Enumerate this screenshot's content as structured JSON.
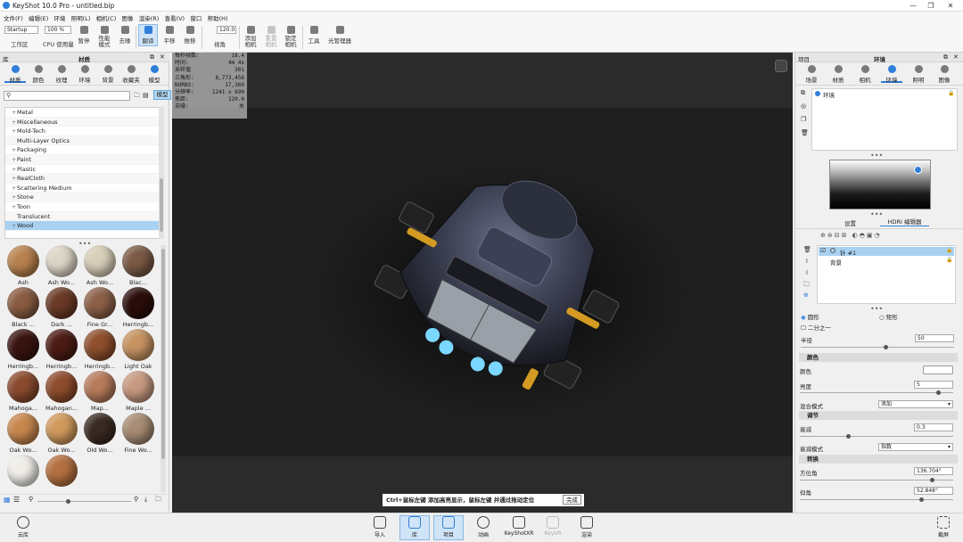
{
  "title": "KeyShot 10.0 Pro  - untitled.bip",
  "menu": [
    "文件(F)",
    "编辑(E)",
    "环境",
    "照明(L)",
    "相机(C)",
    "图像",
    "渲染(R)",
    "查看(V)",
    "窗口",
    "帮助(H)"
  ],
  "toolbar": {
    "workspace_select": "Startup",
    "workspace_label": "工作区",
    "zoom_select": "100 %",
    "cpu_label": "CPU 使用量",
    "pause_label": "暂停",
    "perf_label": "性能\n模式",
    "denoise_label": "去噪",
    "flip_label": "翻译",
    "pan_label": "平移",
    "push_label": "推移",
    "fov_value": "120.0",
    "fov_label": "视角",
    "add_camera_label": "添加\n相机",
    "reset_camera_label": "重置\n相机",
    "lock_camera_label": "锁定\n相机",
    "tools_label": "工具",
    "light_manager_label": "光管理器"
  },
  "library": {
    "panel_title": "库",
    "material_header": "材质",
    "tabs": [
      "材质",
      "颜色",
      "纹理",
      "环境",
      "背景",
      "收藏夹",
      "模型"
    ],
    "tooltip": "模型",
    "tree_items": [
      "Metal",
      "Miscellaneous",
      "Mold-Tech",
      "Multi-Layer Optics",
      "Packaging",
      "Paint",
      "Plastic",
      "RealCloth",
      "Scattering Medium",
      "Stone",
      "Toon",
      "Translucent",
      "Wood"
    ],
    "tree_expandable": [
      true,
      true,
      true,
      false,
      true,
      true,
      true,
      true,
      true,
      true,
      true,
      false,
      true
    ],
    "selected_item": "Wood",
    "materials": [
      "Ash",
      "Ash Wo...",
      "Ash Wo...",
      "Blac...",
      "Black ...",
      "Dark ...",
      "Fine Gr...",
      "Herringb...",
      "Herringb...",
      "Herringb...",
      "Herringb...",
      "Light Oak",
      "Mahoga...",
      "Mahogan...",
      "Map...",
      "Maple ...",
      "Oak Wo...",
      "Oak Wo...",
      "Old Wo...",
      "Fine Wo...",
      "",
      ""
    ],
    "material_colors": [
      "#b9834f",
      "#ddd6c8",
      "#d8cfb9",
      "#7a5a45",
      "#8a5c42",
      "#6a3a26",
      "#8c6048",
      "#2b0e0b",
      "#3a1410",
      "#4c1c14",
      "#8f4f2d",
      "#c79462",
      "#8a4a2e",
      "#8e4c2c",
      "#b87c5c",
      "#c89a82",
      "#c7874d",
      "#d19a5d",
      "#3a2a22",
      "#a88c74",
      "#f0eee8",
      "#b47040"
    ]
  },
  "viewport": {
    "stats": [
      {
        "k": "每秒帧数:",
        "v": "18.4"
      },
      {
        "k": "时间:",
        "v": "4m 4s"
      },
      {
        "k": "采样值",
        "v": "301"
      },
      {
        "k": "三角形:",
        "v": "8,773,456"
      },
      {
        "k": "NURBS:",
        "v": "17,369"
      },
      {
        "k": "分辨率:",
        "v": "1241 x 690"
      },
      {
        "k": "焦距:",
        "v": "120.0"
      },
      {
        "k": "去噪:",
        "v": "关"
      }
    ],
    "hint": "Ctrl+鼠标左键 添加高亮显示，鼠标左键 并通过拖动定位",
    "hint_done": "完成"
  },
  "right_panel": {
    "project_label": "项目",
    "env_header": "环境",
    "tabs": [
      "场景",
      "材质",
      "相机",
      "环境",
      "照明",
      "图像"
    ],
    "env_item": "环境",
    "subtabs": [
      "设置",
      "HDRI 编辑器"
    ],
    "pins": [
      "针 #1",
      "背景"
    ],
    "shape_circle": "圆形",
    "shape_rect": "矩形",
    "half_label": "二分之一",
    "radius_label": "半径",
    "radius_value": "50",
    "color_section": "颜色",
    "color_label": "颜色",
    "brightness_label": "亮度",
    "brightness_value": "5",
    "blend_label": "混合模式",
    "blend_value": "添加",
    "adjust_section": "调节",
    "falloff_label": "衰减",
    "falloff_value": "0.3",
    "falloff_mode_label": "衰减模式",
    "falloff_mode_value": "指数",
    "transform_section": "转换",
    "azimuth_label": "方位角",
    "azimuth_value": "136.704°",
    "elevation_label": "仰角",
    "elevation_value": "52.848°"
  },
  "bottom_bar": {
    "cloud": "云库",
    "items": [
      "导入",
      "库",
      "项目",
      "动画",
      "KeyShotXR",
      "KeyVR",
      "渲染"
    ],
    "screenshot": "截屏"
  }
}
